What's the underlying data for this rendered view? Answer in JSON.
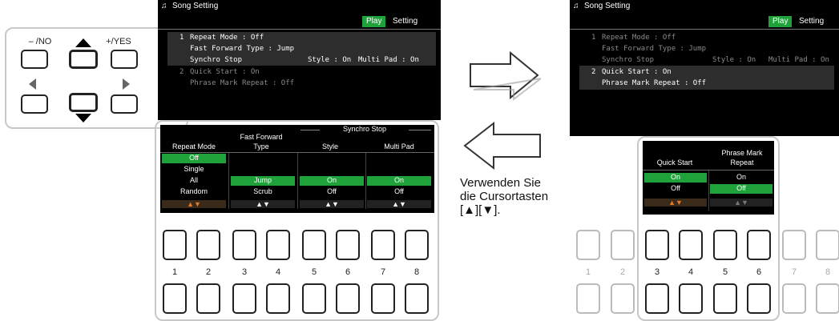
{
  "left_screen": {
    "title": "Song Setting",
    "tabs": [
      "Play",
      "Setting"
    ],
    "rows": [
      {
        "num": "1",
        "text": "Repeat Mode : Off"
      },
      {
        "num": "",
        "text": "Fast Forward Type : Jump"
      },
      {
        "num": "",
        "text": "Synchro Stop",
        "style": "Style : On",
        "multi": "Multi Pad : On"
      },
      {
        "num": "2",
        "text": "Quick Start : On"
      },
      {
        "num": "",
        "text": "Phrase Mark Repeat : Off"
      }
    ]
  },
  "right_screen": {
    "title": "Song Setting",
    "tabs": [
      "Play",
      "Setting"
    ],
    "rows": [
      {
        "num": "1",
        "text": "Repeat Mode : Off"
      },
      {
        "num": "",
        "text": "Fast Forward Type : Jump"
      },
      {
        "num": "",
        "text": "Synchro Stop",
        "style": "Style : On",
        "multi": "Multi Pad : On"
      },
      {
        "num": "2",
        "text": "Quick Start : On"
      },
      {
        "num": "",
        "text": "Phrase Mark Repeat : Off"
      }
    ]
  },
  "cursor_panel": {
    "no_label": "– /NO",
    "yes_label": "+/YES"
  },
  "left_menu": {
    "headers": {
      "repeat_mode": "Repeat Mode",
      "fast_forward": "Fast Forward",
      "fast_forward_2": "Type",
      "synchro_stop": "Synchro Stop",
      "style": "Style",
      "multi_pad": "Multi Pad"
    },
    "repeat_options": [
      "Off",
      "Single",
      "All",
      "Random"
    ],
    "ff_options": [
      "Jump",
      "Scrub"
    ],
    "style_options": [
      "On",
      "Off"
    ],
    "multi_options": [
      "On",
      "Off"
    ],
    "arrows": "▲▼"
  },
  "right_menu": {
    "headers": {
      "quick_start": "Quick Start",
      "phrase_mark": "Phrase Mark",
      "phrase_mark_2": "Repeat"
    },
    "quick_options": [
      "On",
      "Off"
    ],
    "phrase_options": [
      "On",
      "Off"
    ],
    "arrows": "▲▼"
  },
  "button_numbers": [
    "1",
    "2",
    "3",
    "4",
    "5",
    "6",
    "7",
    "8"
  ],
  "instruction": {
    "line1": "Verwenden Sie",
    "line2": "die Cursortasten",
    "line3": "[▲][▼]."
  }
}
